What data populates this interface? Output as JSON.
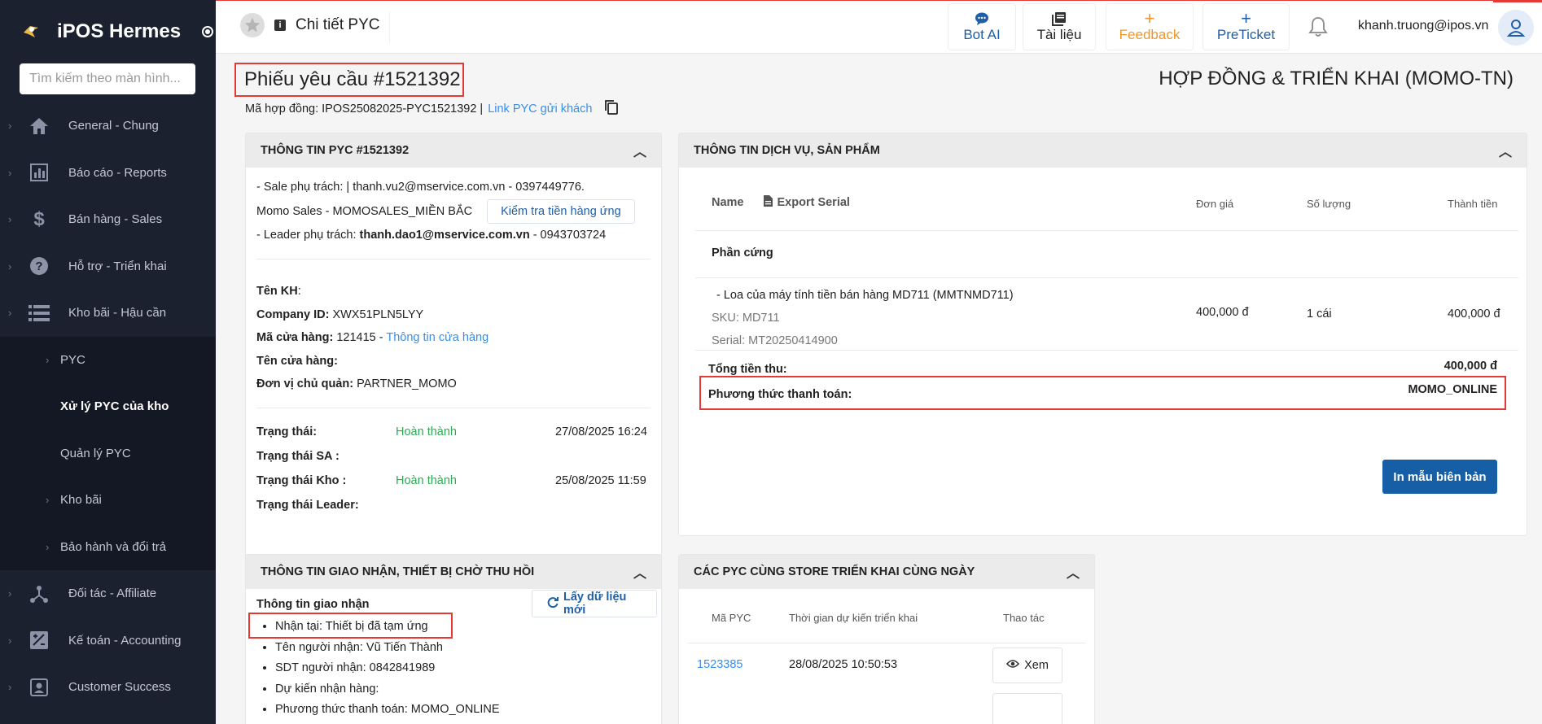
{
  "sidebar": {
    "app_title": "iPOS Hermes",
    "search_placeholder": "Tìm kiếm theo màn hình...",
    "items": [
      {
        "label": "General - Chung",
        "icon": "home-icon"
      },
      {
        "label": "Báo cáo - Reports",
        "icon": "chart-icon"
      },
      {
        "label": "Bán hàng - Sales",
        "icon": "dollar-icon"
      },
      {
        "label": "Hỗ trợ - Triển khai",
        "icon": "help-icon"
      },
      {
        "label": "Kho bãi - Hậu cần",
        "icon": "list-icon"
      }
    ],
    "sub_items": [
      {
        "label": "PYC"
      },
      {
        "label": "Xử lý PYC của kho"
      },
      {
        "label": "Quản lý PYC"
      },
      {
        "label": "Kho bãi"
      },
      {
        "label": "Bảo hành và đổi trả"
      }
    ],
    "items_bottom": [
      {
        "label": "Đối tác - Affiliate",
        "icon": "network-icon"
      },
      {
        "label": "Kế toán - Accounting",
        "icon": "accounting-icon"
      },
      {
        "label": "Customer Success",
        "icon": "contact-icon"
      }
    ]
  },
  "topbar": {
    "page_title": "Chi tiết PYC",
    "bot_ai": "Bot AI",
    "docs": "Tài liệu",
    "feedback": "Feedback",
    "preticket": "PreTicket",
    "user_email": "khanh.truong@ipos.vn",
    "colors": {
      "blue": "#1f5fa8",
      "orange": "#f0962a"
    }
  },
  "header": {
    "request_title": "Phiếu yêu cầu #1521392",
    "contract_code": "Mã hợp đồng: IPOS25082025-PYC1521392 |",
    "link_label": "Link PYC gửi khách",
    "right_title": "HỢP ĐỒNG & TRIỂN KHAI (MOMO-TN)"
  },
  "pyc_info": {
    "header": "THÔNG TIN PYC #1521392",
    "sale_line": "- Sale phụ trách: | thanh.vu2@mservice.com.vn - 0397449776.",
    "sales_team": "Momo Sales - MOMOSALES_MIỀN BẮC",
    "check_button": "Kiểm tra tiền hàng ứng",
    "leader_prefix": "- Leader phụ trách:",
    "leader_email": "thanh.dao1@mservice.com.vn",
    "leader_phone": "- 0943703724",
    "customer_label": "Tên KH",
    "customer_colon": ":",
    "company_label": "Company ID:",
    "company_value": "XWX51PLN5LYY",
    "store_code_label": "Mã cửa hàng:",
    "store_code_value": "121415 -",
    "store_info_link": "Thông tin cửa hàng",
    "store_name_label": "Tên cửa hàng:",
    "unit_label": "Đơn vị chủ quản:",
    "unit_value": "PARTNER_MOMO",
    "status": [
      {
        "label": "Trạng thái:",
        "value": "Hoàn thành",
        "time": "27/08/2025 16:24"
      },
      {
        "label": "Trạng thái SA :",
        "value": "",
        "time": ""
      },
      {
        "label": "Trạng thái Kho :",
        "value": "Hoàn thành",
        "time": "25/08/2025 11:59"
      },
      {
        "label": "Trạng thái Leader:",
        "value": "",
        "time": ""
      }
    ]
  },
  "service_info": {
    "header": "THÔNG TIN DỊCH VỤ, SẢN PHẨM",
    "col_name": "Name",
    "export_serial": "Export Serial",
    "col_price": "Đơn giá",
    "col_qty": "Số lượng",
    "col_total": "Thành tiền",
    "group": "Phần cứng",
    "product_name": "- Loa của máy tính tiền bán hàng MD711 (MMTNMD711)",
    "sku": "SKU: MD711",
    "serial": "Serial: MT20250414900",
    "price": "400,000 đ",
    "qty": "1 cái",
    "total": "400,000 đ",
    "sum_label": "Tổng tiền thu:",
    "sum_value": "400,000 đ",
    "pay_label": "Phương thức thanh toán:",
    "pay_value": "MOMO_ONLINE",
    "print_button": "In mẫu biên bản"
  },
  "delivery": {
    "header": "THÔNG TIN GIAO NHẬN, THIẾT BỊ CHỜ THU HỒI",
    "subheader": "Thông tin giao nhận",
    "refresh_button": "Lấy dữ liệu mới",
    "lines": [
      "Nhận tại: Thiết bị đã tạm ứng",
      "Tên người nhận: Vũ Tiến Thành",
      "SDT người nhận: 0842841989",
      "Dự kiến nhận hàng:",
      "Phương thức thanh toán: MOMO_ONLINE"
    ]
  },
  "same_store": {
    "header": "CÁC PYC CÙNG STORE TRIỂN KHAI CÙNG NGÀY",
    "col_code": "Mã PYC",
    "col_time": "Thời gian dự kiến triển khai",
    "col_action": "Thao tác",
    "rows": [
      {
        "code": "1523385",
        "time": "28/08/2025 10:50:53",
        "action": "Xem"
      }
    ]
  }
}
